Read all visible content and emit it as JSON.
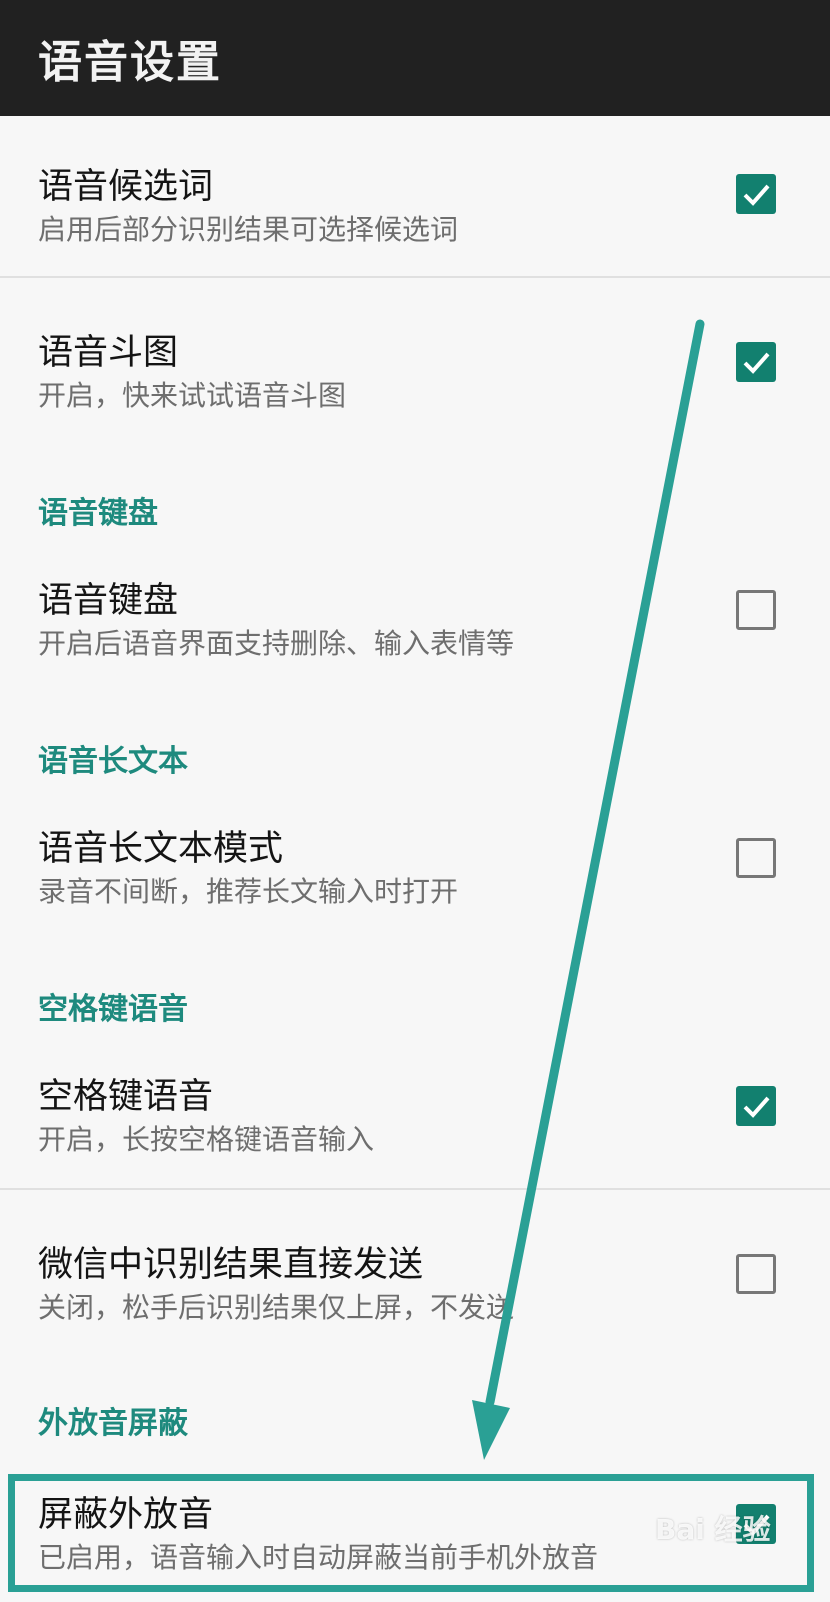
{
  "header": {
    "title": "语音设置"
  },
  "settings": [
    {
      "title": "语音候选词",
      "subtitle": "启用后部分识别结果可选择候选词",
      "checked": true
    },
    {
      "title": "语音斗图",
      "subtitle": "开启，快来试试语音斗图",
      "checked": true
    },
    {
      "category": "语音键盘"
    },
    {
      "title": "语音键盘",
      "subtitle": "开启后语音界面支持删除、输入表情等",
      "checked": false
    },
    {
      "category": "语音长文本"
    },
    {
      "title": "语音长文本模式",
      "subtitle": "录音不间断，推荐长文输入时打开",
      "checked": false
    },
    {
      "category": "空格键语音"
    },
    {
      "title": "空格键语音",
      "subtitle": "开启，长按空格键语音输入",
      "checked": true
    },
    {
      "title": "微信中识别结果直接发送",
      "subtitle": "关闭，松手后识别结果仅上屏，不发送",
      "checked": false
    },
    {
      "category": "外放音屏蔽"
    },
    {
      "title": "屏蔽外放音",
      "subtitle": "已启用，语音输入时自动屏蔽当前手机外放音",
      "checked": true
    }
  ],
  "colors": {
    "accent": "#12806f",
    "category": "#1e8a7e",
    "annotation": "#2aa095",
    "appbar": "#212121"
  },
  "watermark": "Bai 经验"
}
